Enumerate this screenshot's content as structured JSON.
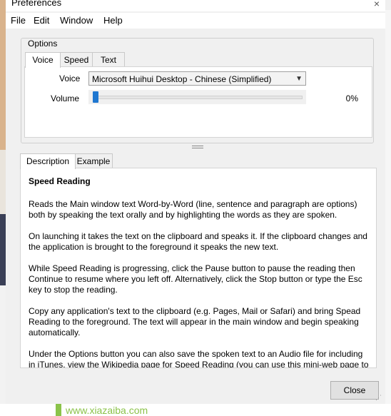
{
  "window": {
    "title": "Preferences",
    "close_glyph": "×"
  },
  "menu": [
    "File",
    "Edit",
    "Window",
    "Help"
  ],
  "options": {
    "legend": "Options",
    "tabs": [
      "Voice",
      "Speed",
      "Text"
    ],
    "active_tab": "Voice",
    "voice_label": "Voice",
    "voice_value": "Microsoft Huihui Desktop - Chinese (Simplified)",
    "volume_label": "Volume",
    "volume_percent_text": "0%",
    "volume_level": 0
  },
  "detail": {
    "tabs": [
      "Description",
      "Example"
    ],
    "active_tab": "Description",
    "heading": "Speed Reading",
    "paragraphs": [
      "Reads the Main window text Word-by-Word (line, sentence and paragraph are options) both by speaking the text orally and by highlighting the words as they are spoken.",
      "On launching it takes the text on the clipboard and speaks it. If the clipboard changes and the application is brought to the foreground it speaks the new text.",
      "While Speed Reading is progressing, click the Pause button to pause the reading then Continue to resume where you left off. Alternatively, click the Stop button or type the Esc key to stop the reading.",
      "Copy any application's text to the clipboard (e.g. Pages, Mail or Safari) and bring Spead Reading to the foreground. The text will appear in the main window and begin speaking automatically.",
      "Under the Options button you can also save the spoken text to an Audio file for including in iTunes, view the Wikipedia page for Speed Reading (you can use this mini-web page to"
    ]
  },
  "close_button": "Close",
  "background": {
    "url_text": "www.xiazaiba.com"
  },
  "colors": {
    "slider_thumb": "#1f77d0",
    "window_bg": "#f0f0f0"
  }
}
